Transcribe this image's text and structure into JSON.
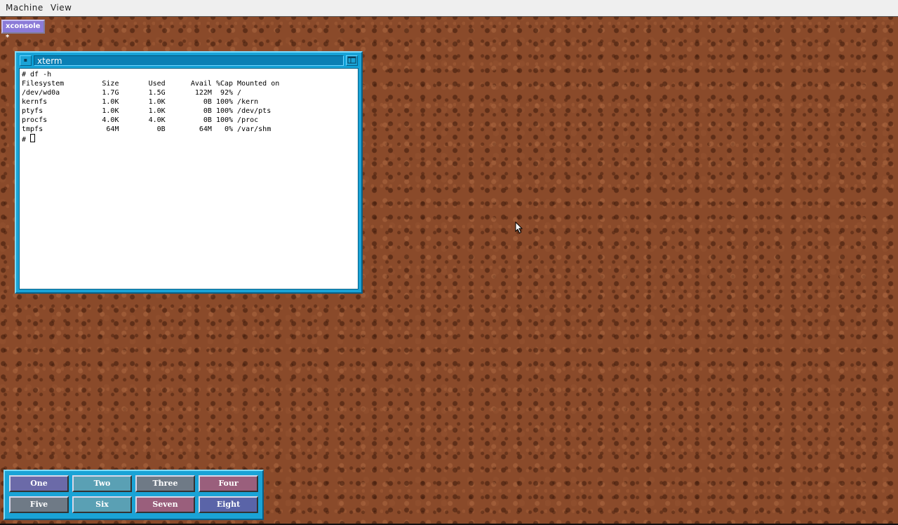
{
  "host": {
    "menu": [
      {
        "label": "Machine"
      },
      {
        "label": "View"
      }
    ]
  },
  "xconsole": {
    "label": "xconsole *"
  },
  "xterm": {
    "title": "xterm",
    "menu_icon": "window-menu-icon",
    "maximize_icon": "maximize-icon",
    "lines": [
      "# df -h",
      "Filesystem         Size       Used      Avail %Cap Mounted on",
      "/dev/wd0a          1.7G       1.5G       122M  92% /",
      "kernfs             1.0K       1.0K         0B 100% /kern",
      "ptyfs              1.0K       1.0K         0B 100% /dev/pts",
      "procfs             4.0K       4.0K         0B 100% /proc",
      "tmpfs               64M         0B        64M   0% /var/shm"
    ],
    "prompt": "# "
  },
  "pager": {
    "desktops": [
      {
        "label": "One",
        "color": "#6b6aa8",
        "active": true
      },
      {
        "label": "Two",
        "color": "#5aa0b4",
        "active": false
      },
      {
        "label": "Three",
        "color": "#6f7a86",
        "active": false
      },
      {
        "label": "Four",
        "color": "#9a5f7c",
        "active": false
      },
      {
        "label": "Five",
        "color": "#6f7a86",
        "active": false
      },
      {
        "label": "Six",
        "color": "#5aa0b4",
        "active": false
      },
      {
        "label": "Seven",
        "color": "#9a5f7c",
        "active": false
      },
      {
        "label": "Eight",
        "color": "#5a64a8",
        "active": false
      }
    ]
  },
  "colors": {
    "desktop": "#8a4a2a",
    "window_frame": "#1aa3d6",
    "xconsole_icon": "#8b7bd8"
  }
}
